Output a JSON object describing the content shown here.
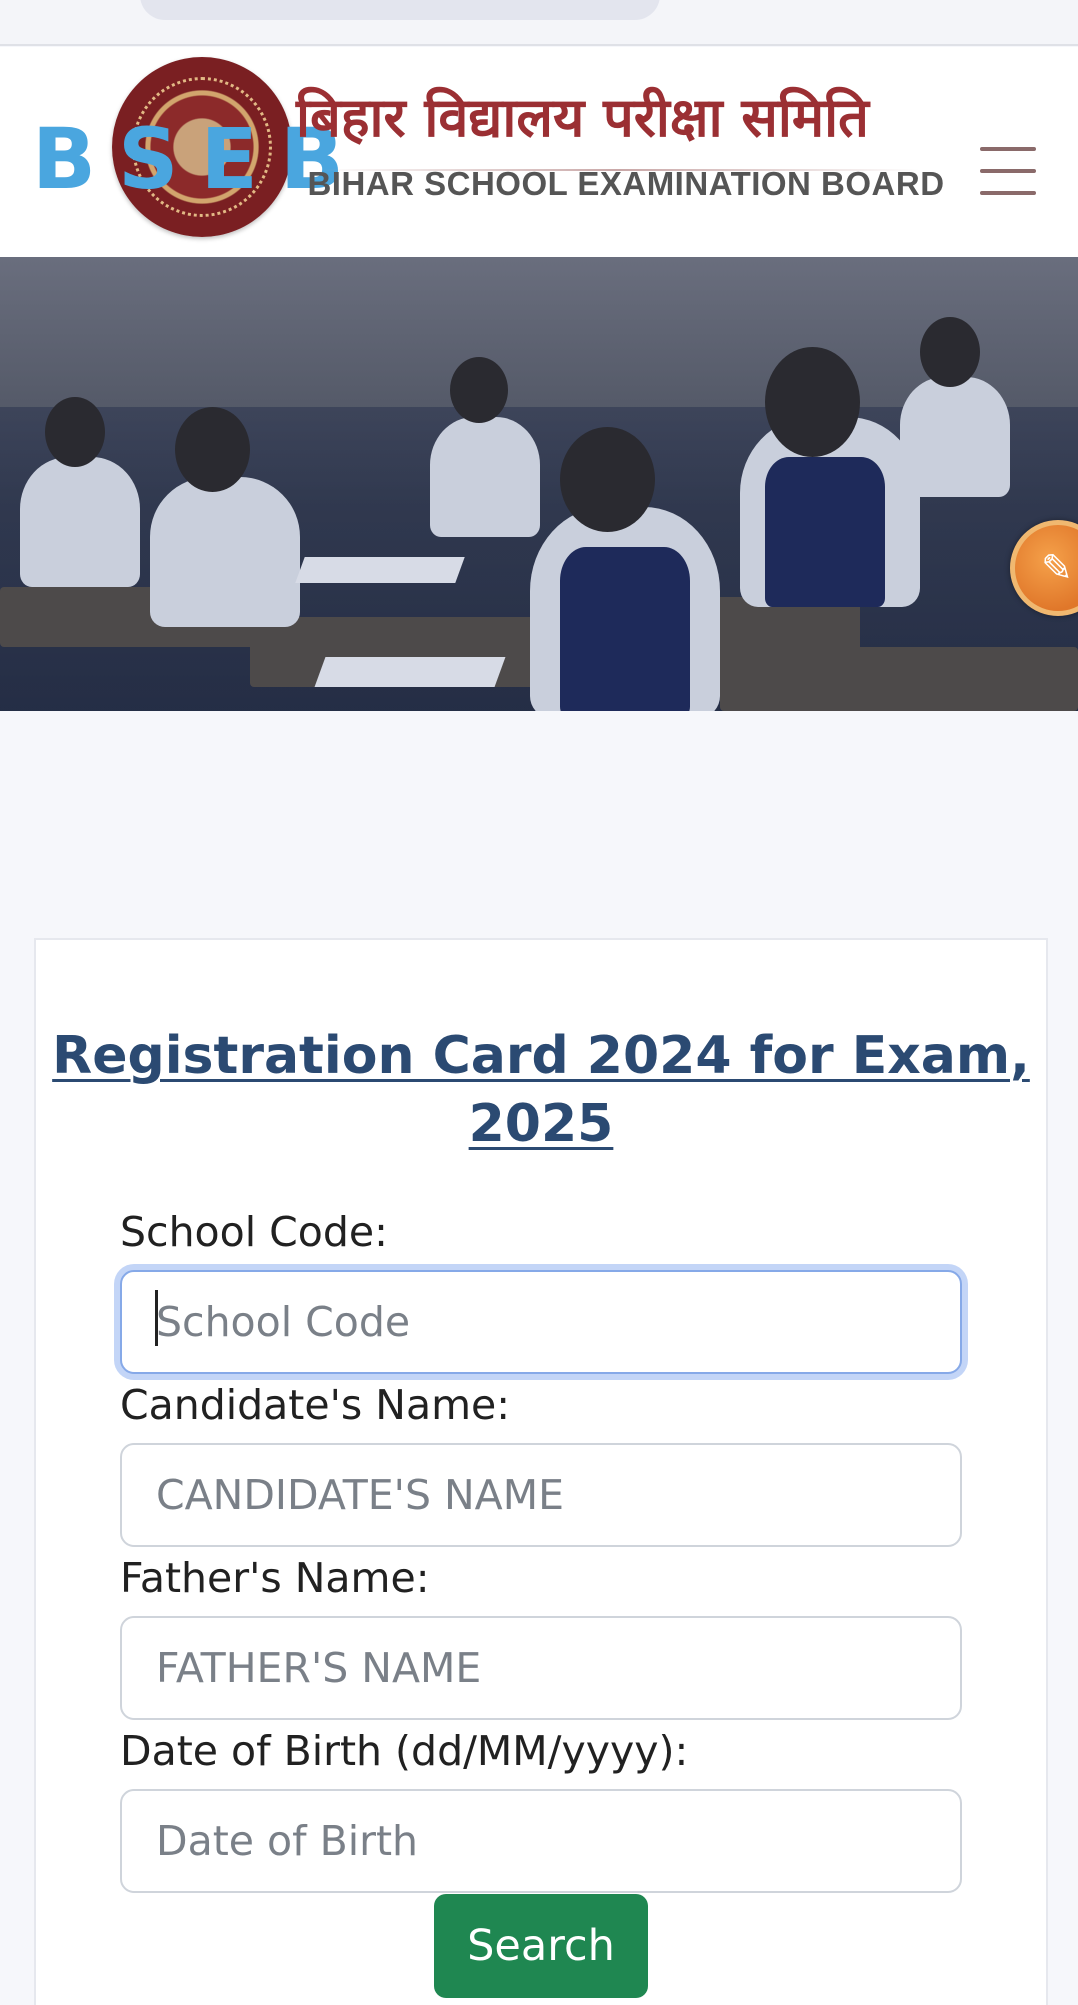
{
  "header": {
    "brand_letters": "BSEB",
    "board_name_hindi": "बिहार विद्यालय परीक्षा समिति",
    "board_name_english": "BIHAR SCHOOL EXAMINATION BOARD",
    "logo": "bseb-emblem",
    "menu_icon": "hamburger-menu-icon"
  },
  "hero": {
    "image": "students-writing-exam-in-classroom",
    "floating_action_icon": "pencil-icon"
  },
  "form": {
    "title": "Registration Card 2024 for Exam, 2025",
    "fields": [
      {
        "label": "School Code:",
        "placeholder": "School Code",
        "value": "",
        "focused": true
      },
      {
        "label": "Candidate's Name:",
        "placeholder": "CANDIDATE'S NAME",
        "value": ""
      },
      {
        "label": "Father's Name:",
        "placeholder": "FATHER'S NAME",
        "value": ""
      },
      {
        "label": "Date of Birth (dd/MM/yyyy):",
        "placeholder": "Date of Birth",
        "value": ""
      }
    ],
    "submit_label": "Search",
    "colors": {
      "title": "#2b4a72",
      "submit_button": "#1f8751",
      "brand_letters": "#4aa6df",
      "hindi_title": "#9b2f33"
    }
  }
}
